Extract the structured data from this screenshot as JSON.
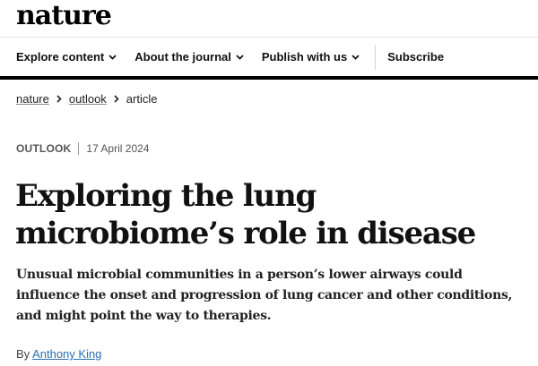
{
  "site": {
    "logo": "nature"
  },
  "nav": {
    "items": [
      {
        "label": "Explore content"
      },
      {
        "label": "About the journal"
      },
      {
        "label": "Publish with us"
      }
    ],
    "subscribe_label": "Subscribe"
  },
  "breadcrumb": {
    "items": [
      "nature",
      "outlook"
    ],
    "current": "article"
  },
  "article": {
    "type": "OUTLOOK",
    "date": "17 April 2024",
    "title": "Exploring the lung microbiome’s role in disease",
    "standfirst": "Unusual microbial communities in a person’s lower airways could influence the onset and progression of lung cancer and other conditions, and might point the way to therapies.",
    "byline_prefix": "By",
    "author": "Anthony King"
  },
  "colors": {
    "accent_link": "#2a6fb4",
    "rule": "#000000"
  },
  "icons": {
    "nav_dropdown": "chevron-down-icon",
    "breadcrumb_separator": "chevron-right-icon"
  }
}
